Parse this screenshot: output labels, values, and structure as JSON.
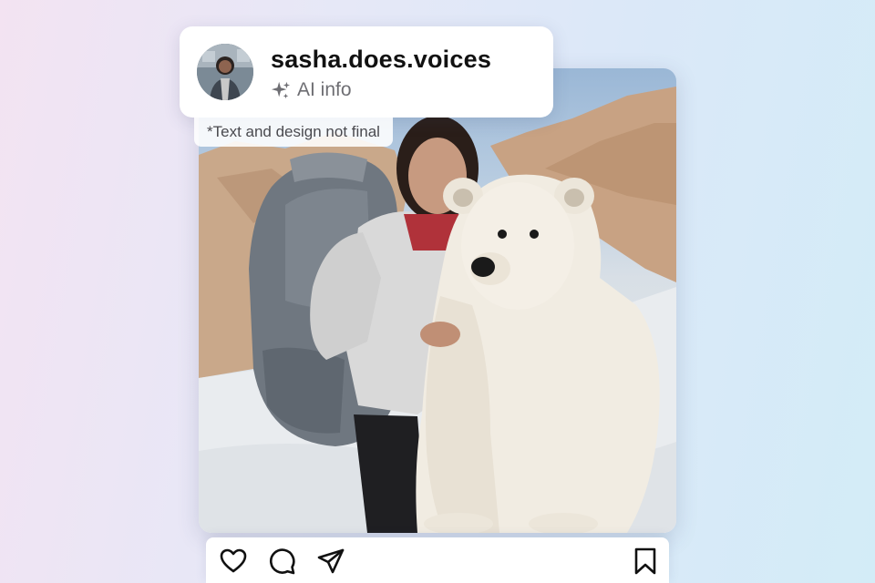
{
  "profile": {
    "username": "sasha.does.voices",
    "ai_label": "AI info",
    "ai_icon": "sparkle-icon",
    "avatar": "profile-avatar"
  },
  "disclaimer": "*Text and design not final",
  "post": {
    "image": "woman-with-backpack-and-polar-bear-in-desert-photo"
  },
  "actions": {
    "like_icon": "heart-icon",
    "comment_icon": "comment-bubble-icon",
    "share_icon": "paper-plane-icon",
    "save_icon": "bookmark-icon"
  },
  "colors": {
    "text_primary": "#111111",
    "text_secondary": "#6e6e73",
    "card_background": "#ffffff"
  }
}
